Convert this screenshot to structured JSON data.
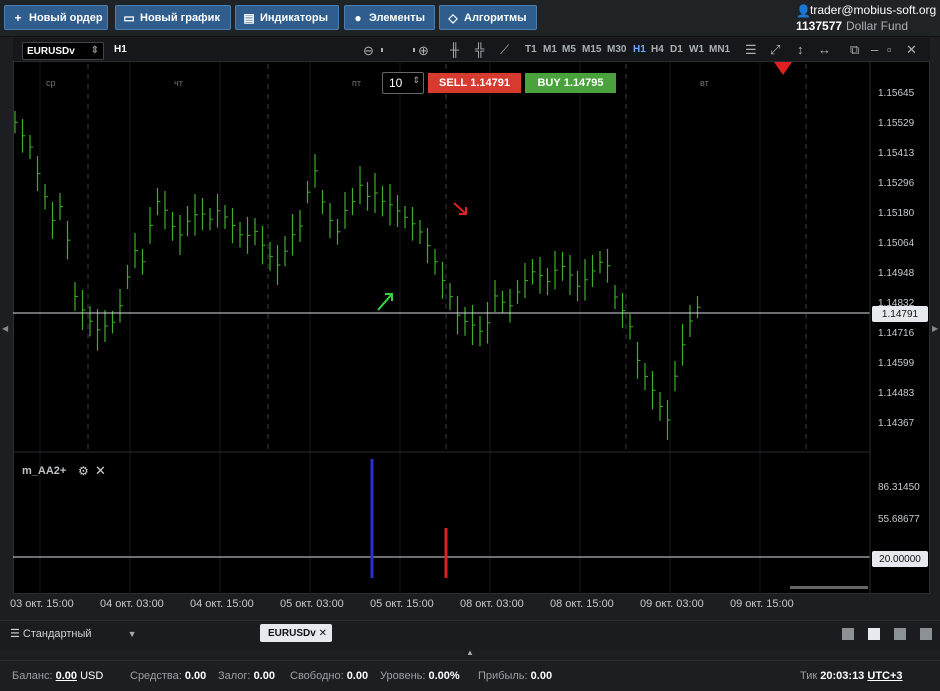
{
  "toolbar": {
    "new_order": "Новый ордер",
    "new_chart": "Новый график",
    "indicators": "Индикаторы",
    "elements": "Элементы",
    "algorithms": "Алгоритмы"
  },
  "account": {
    "user": "trader@mobius-soft.org",
    "number": "1137577",
    "fund": "Dollar Fund"
  },
  "chart": {
    "symbol": "EURUSDv",
    "timeframe": "H1",
    "timeframes": [
      "T1",
      "M1",
      "M5",
      "M15",
      "M30",
      "H1",
      "H4",
      "D1",
      "W1",
      "MN1"
    ],
    "active_timeframe": "H1",
    "day_labels": [
      "ср",
      "чт",
      "пт",
      "вт"
    ],
    "price_axis": [
      "1.15645",
      "1.15529",
      "1.15413",
      "1.15296",
      "1.15180",
      "1.15064",
      "1.14948",
      "1.14832",
      "1.14716",
      "1.14599",
      "1.14483",
      "1.14367"
    ],
    "current_price": "1.14791",
    "time_axis": [
      "03 окт. 15:00",
      "04 окт. 03:00",
      "04 окт. 15:00",
      "05 окт. 03:00",
      "05 окт. 15:00",
      "08 окт. 03:00",
      "08 окт. 15:00",
      "09 окт. 03:00",
      "09 окт. 15:00"
    ]
  },
  "trade": {
    "quantity": "10",
    "sell_label": "SELL",
    "sell_price": "1.14791",
    "buy_label": "BUY",
    "buy_price": "1.14795"
  },
  "indicator": {
    "name": "m_AA2+",
    "axis": [
      "86.31450",
      "55.68677"
    ],
    "level": "20.00000"
  },
  "tabs": {
    "workspace": "Стандартный",
    "symbol_tab": "EURUSDv"
  },
  "status": {
    "balance_label": "Баланс:",
    "balance": "0.00",
    "currency": "USD",
    "funds_label": "Средства:",
    "funds": "0.00",
    "margin_label": "Залог:",
    "margin": "0.00",
    "free_label": "Свободно:",
    "free": "0.00",
    "level_label": "Уровень:",
    "level": "0.00%",
    "profit_label": "Прибыль:",
    "profit": "0.00",
    "tick_label": "Тик",
    "time": "20:03:13",
    "tz": "UTC+3"
  },
  "colors": {
    "bar": "#3fae2a",
    "sell": "#d73b30",
    "buy": "#4aa23d",
    "accent": "#2f5e8e"
  }
}
